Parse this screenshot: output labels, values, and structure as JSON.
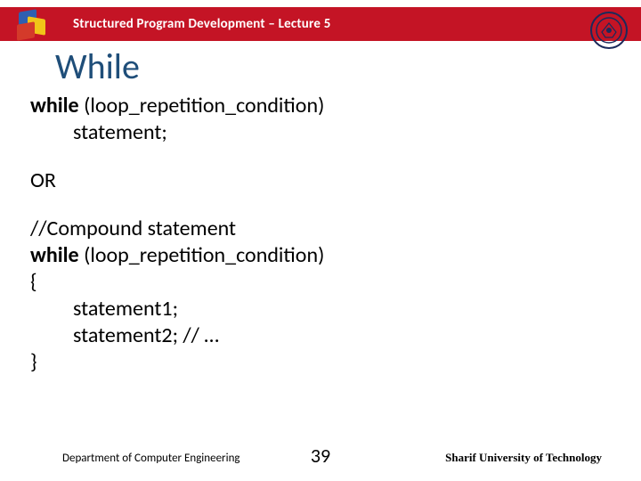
{
  "topbar": {
    "title": "Structured Program Development – Lecture 5"
  },
  "heading": "While",
  "code": {
    "l1a": "while ",
    "l1b": "(loop_repetition_condition)",
    "l2": "statement;",
    "or": "OR",
    "c1": "//Compound statement",
    "c2a": "while ",
    "c2b": "(loop_repetition_condition)",
    "c3": "{",
    "c4": "statement1;",
    "c5": "statement2;  // …",
    "c6": "}"
  },
  "footer": {
    "dept": "Department of Computer Engineering",
    "page": "39",
    "uni": "Sharif University of Technology"
  }
}
